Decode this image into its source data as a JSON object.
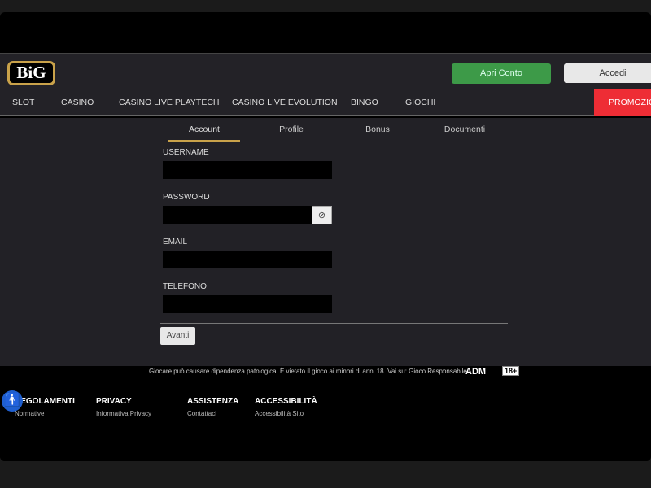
{
  "header": {
    "logo": "BiG",
    "open_account": "Apri Conto",
    "login": "Accedi"
  },
  "nav": [
    "SLOT",
    "CASINO",
    "CASINO LIVE PLAYTECH",
    "CASINO LIVE EVOLUTION",
    "BINGO",
    "GIOCHI"
  ],
  "nav_promo": "PROMOZIONI",
  "tabs": [
    "Account",
    "Profile",
    "Bonus",
    "Documenti"
  ],
  "active_tab": "Account",
  "form": {
    "username": "USERNAME",
    "password": "PASSWORD",
    "email": "EMAIL",
    "phone": "TELEFONO",
    "next": "Avanti",
    "eye_icon": "eye-slash-icon"
  },
  "footer": {
    "warning": "Giocare può causare dipendenza patologica. È vietato il gioco ai minori di anni 18. Vai su: Gioco Responsabile",
    "adm": "ADM",
    "age": "18+",
    "cols": [
      {
        "h": "REGOLAMENTI",
        "l": "Normative"
      },
      {
        "h": "PRIVACY",
        "l": "Informativa Privacy"
      },
      {
        "h": "ASSISTENZA",
        "l": "Contattaci"
      },
      {
        "h": "ACCESSIBILITÀ",
        "l": "Accessibilità Sito"
      }
    ]
  },
  "colors": {
    "accent_gold": "#c9a24a",
    "green": "#3d9a48",
    "promo_red": "#ee2d35",
    "accessibility_blue": "#1f5fcf"
  }
}
